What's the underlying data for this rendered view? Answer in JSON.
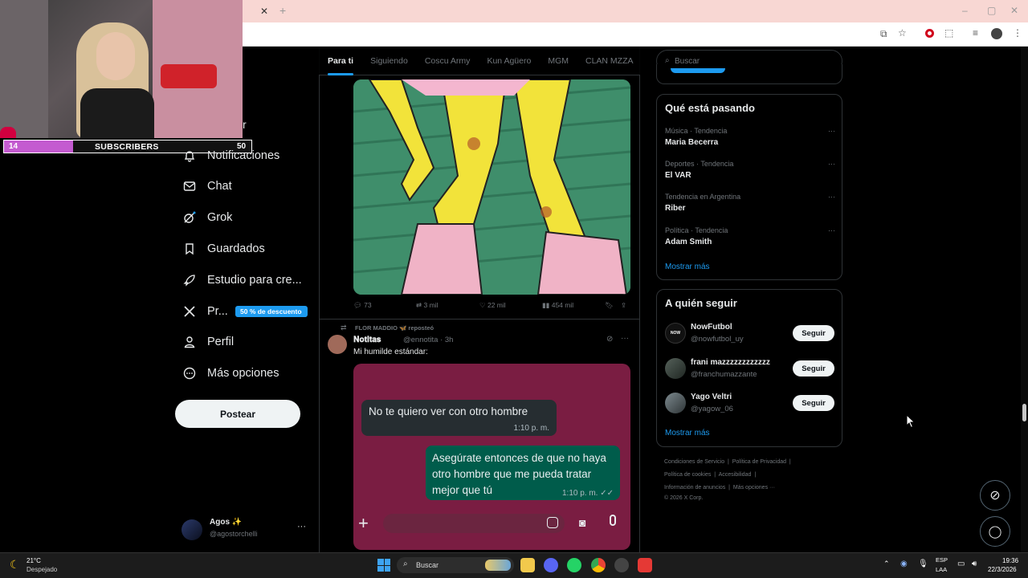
{
  "overlay": {
    "subscribers_label": "SUBSCRIBERS",
    "subscribers_current": "14",
    "subscribers_goal": "50",
    "progress_fraction": 0.28
  },
  "nav": {
    "partial_label": "r",
    "items": [
      {
        "label": "Notificaciones",
        "icon": "bell-icon"
      },
      {
        "label": "Chat",
        "icon": "mail-icon"
      },
      {
        "label": "Grok",
        "icon": "grok-icon"
      },
      {
        "label": "Guardados",
        "icon": "bookmark-icon"
      },
      {
        "label": "Estudio para cre...",
        "icon": "rocket-icon"
      },
      {
        "label": "Pr...",
        "icon": "x-logo-icon",
        "badge": "50 % de descuento"
      },
      {
        "label": "Perfil",
        "icon": "person-icon"
      },
      {
        "label": "Más opciones",
        "icon": "more-circle-icon"
      }
    ],
    "post_label": "Postear",
    "account": {
      "name": "Agos ✨",
      "handle": "@agostorchelli",
      "more": "···"
    }
  },
  "tabs": [
    "Para ti",
    "Siguiendo",
    "Coscu Army",
    "Kun Agüero",
    "MGM",
    "CLAN MZZA"
  ],
  "post1": {
    "replies": "73",
    "reposts": "3 mil",
    "likes": "22 mil",
    "views": "454 mil"
  },
  "post2": {
    "reposted_by": "FLOR MADDIO 🦋 reposteó",
    "author": "𝐍𝐨𝐭𝐢𝐭𝐚𝐬",
    "handle_time": "@ennotita · 3h",
    "text": "Mi humilde estándar:",
    "chat": {
      "received": "No te quiero ver con otro hombre",
      "received_time": "1:10 p. m.",
      "sent": "Asegúrate entonces de que no haya otro hombre que me pueda tratar mejor que tú",
      "sent_time": "1:10 p. m. ✓✓"
    }
  },
  "search": {
    "placeholder": "Buscar"
  },
  "trends": {
    "title": "Qué está pasando",
    "items": [
      {
        "category": "Música · Tendencia",
        "name": "Maria Becerra"
      },
      {
        "category": "Deportes · Tendencia",
        "name": "El VAR"
      },
      {
        "category": "Tendencia en Argentina",
        "name": "Riber"
      },
      {
        "category": "Política · Tendencia",
        "name": "Adam Smith"
      }
    ],
    "more": "Mostrar más"
  },
  "who_to_follow": {
    "title": "A quién seguir",
    "items": [
      {
        "name": "NowFutbol",
        "handle": "@nowfutbol_uy",
        "button": "Seguir"
      },
      {
        "name": "frani mazzzzzzzzzzzz",
        "handle": "@franchumazzante",
        "button": "Seguir"
      },
      {
        "name": "Yago Veltri",
        "handle": "@yagow_06",
        "button": "Seguir"
      }
    ],
    "more": "Mostrar más"
  },
  "footer": {
    "links": [
      "Condiciones de Servicio",
      "Política de Privacidad",
      "Política de cookies",
      "Accesibilidad",
      "Información de anuncios",
      "Más opciones ···"
    ],
    "copyright": "© 2026 X Corp."
  },
  "taskbar": {
    "weather_temp": "21°C",
    "weather_desc": "Despejado",
    "search_placeholder": "Buscar",
    "lang_top": "ESP",
    "lang_bottom": "LAA",
    "time": "19:36",
    "date": "22/3/2026"
  },
  "colors": {
    "accent": "#1d9bf0",
    "chat_bg": "#7a1d42",
    "bubble_received": "#262d31",
    "bubble_sent": "#005c4b",
    "progress": "#c45bd0"
  }
}
